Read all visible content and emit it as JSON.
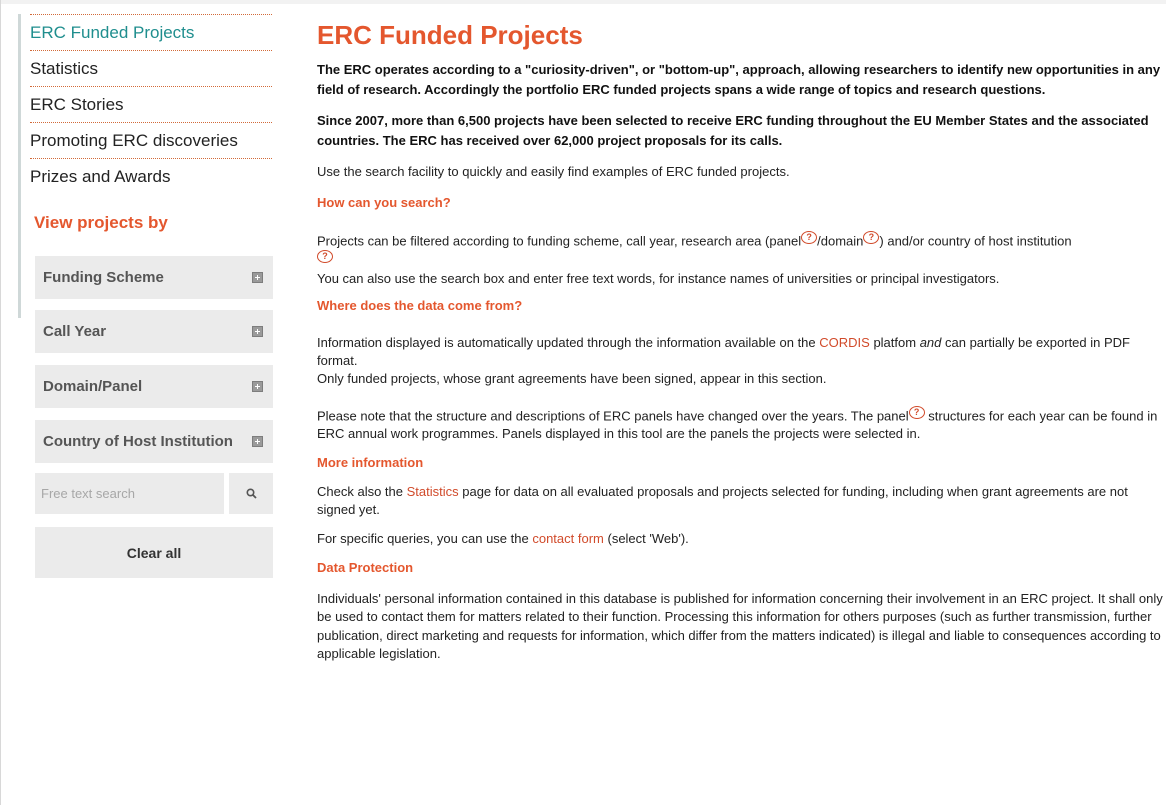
{
  "sidebar": {
    "nav": [
      {
        "label": "ERC Funded Projects"
      },
      {
        "label": "Statistics"
      },
      {
        "label": "ERC Stories"
      },
      {
        "label": "Promoting ERC discoveries"
      },
      {
        "label": "Prizes and Awards"
      }
    ],
    "view_heading": "View projects by",
    "filters": [
      {
        "label": "Funding Scheme"
      },
      {
        "label": "Call Year"
      },
      {
        "label": "Domain/Panel"
      },
      {
        "label": "Country of Host Institution"
      }
    ],
    "search_placeholder": "Free text search",
    "clear_label": "Clear all"
  },
  "main": {
    "title": "ERC Funded Projects",
    "intro1": "The ERC operates according to a \"curiosity-driven\", or \"bottom-up\", approach, allowing researchers to identify new opportunities in any field of research. Accordingly the portfolio ERC funded projects spans a wide range of topics and research questions.",
    "intro2": "Since 2007, more than 6,500 projects have been selected to receive ERC funding throughout the EU Member States and the associated countries. The ERC has received over 62,000 project proposals for its calls.",
    "use_search": "Use the search facility to quickly and easily find examples of ERC funded projects.",
    "how_head": "How can you search?",
    "how_p1_a": "Projects can be filtered according to funding scheme, call year, research area (panel",
    "how_p1_b": "/domain",
    "how_p1_c": ") and/or country of host institution",
    "how_p2": "You can also use the search box and enter free text words, for instance names of universities or principal investigators.",
    "where_head": "Where does the data come from?",
    "where_p1_a": "Information displayed is automatically updated through the information available on the ",
    "where_link": "CORDIS",
    "where_p1_b": " platfom ",
    "where_p1_and": "and",
    "where_p1_c": " can partially be exported in PDF format.",
    "where_p2": "Only funded projects, whose grant agreements have been signed, appear in this section.",
    "note_a": "Please note that the structure and descriptions of ERC panels have changed over the years. The panel",
    "note_b": " structures for each year can be found in ERC annual work programmes. Panels displayed in this tool are the panels the projects were selected in.",
    "more_head": "More information",
    "more_p1_a": "Check also the ",
    "more_link": "Statistics",
    "more_p1_b": " page for data on all evaluated proposals and projects selected for funding, including when grant agreements are not signed yet.",
    "more_p2_a": "For specific queries, you can use the ",
    "more_p2_link": "contact form",
    "more_p2_b": " (select 'Web').",
    "dp_head": "Data Protection",
    "dp_p": "Individuals' personal information contained in this database is published for information concerning their involvement in an ERC project. It shall only be used to contact them for matters related to their function. Processing this information for others purposes (such as further transmission, further publication, direct marketing and requests for information, which differ from the matters indicated) is illegal and liable to consequences according to applicable legislation.",
    "q_glyph": "?"
  }
}
